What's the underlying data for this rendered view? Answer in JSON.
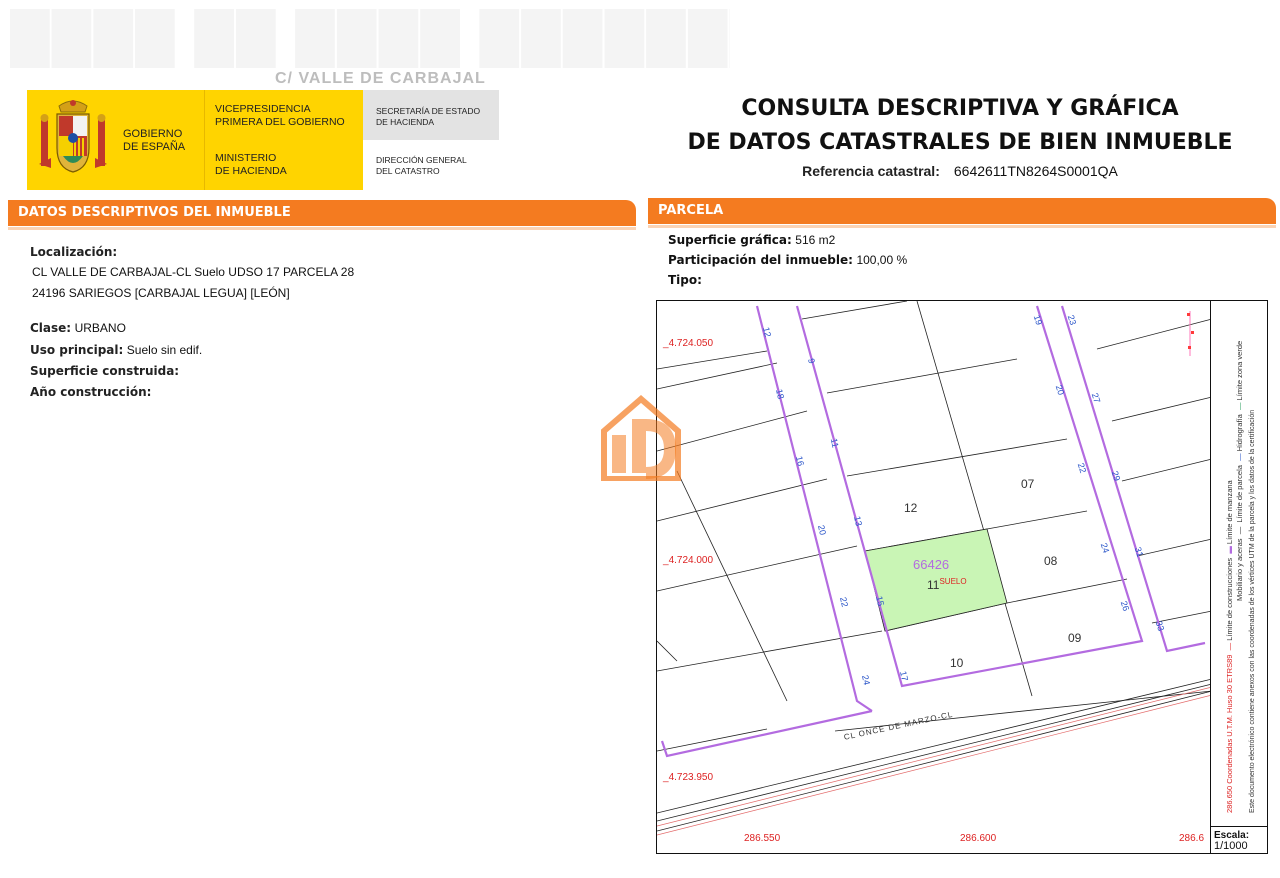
{
  "header": {
    "ghost_sub": "C/ VALLE DE CARBAJAL",
    "gobierno": "GOBIERNO\nDE ESPAÑA",
    "vicepresidencia": "VICEPRESIDENCIA\nPRIMERA DEL GOBIERNO",
    "ministerio": "MINISTERIO\nDE HACIENDA",
    "secretaria": "SECRETARÍA DE ESTADO\nDE HACIENDA",
    "direccion": "DIRECCIÓN GENERAL\nDEL CATASTRO",
    "title_line1": "CONSULTA DESCRIPTIVA Y GRÁFICA",
    "title_line2": "DE DATOS CATASTRALES DE BIEN INMUEBLE",
    "ref_label": "Referencia catastral:",
    "ref_value": "6642611TN8264S0001QA"
  },
  "descriptivos": {
    "heading": "DATOS DESCRIPTIVOS DEL INMUEBLE",
    "localizacion_label": "Localización:",
    "localizacion_line1": "CL VALLE DE CARBAJAL-CL  Suelo UDSO 17 PARCELA 28",
    "localizacion_line2": "24196 SARIEGOS [CARBAJAL LEGUA] [LEÓN]",
    "clase_label": "Clase:",
    "clase_value": "URBANO",
    "uso_label": "Uso principal:",
    "uso_value": "Suelo sin edif.",
    "superficie_label": "Superficie construida:",
    "anio_label": "Año construcción:"
  },
  "parcela": {
    "heading": "PARCELA",
    "superficie_label": "Superficie gráfica:",
    "superficie_value": "516 m2",
    "participacion_label": "Participación del inmueble:",
    "participacion_value": "100,00 %",
    "tipo_label": "Tipo:"
  },
  "map": {
    "y_labels": [
      "4.724.050",
      "4.724.000",
      "4.723.950"
    ],
    "x_labels": [
      "286.550",
      "286.600",
      "286.6"
    ],
    "manzana_label": "66426",
    "parcel_number": "11",
    "suelo_label": "SUELO",
    "street_label": "CL ONCE DE MARZO-CL",
    "parcel_labels": [
      "12",
      "07",
      "08",
      "09",
      "10"
    ],
    "street_numbers_left": [
      "12",
      "9",
      "18",
      "11",
      "16",
      "13",
      "20",
      "15",
      "22",
      "17",
      "24"
    ],
    "street_numbers_right": [
      "19",
      "23",
      "20",
      "27",
      "22",
      "29",
      "24",
      "31",
      "26",
      "33"
    ],
    "legend_1": "Límite de manzana",
    "legend_2": "Límite de parcela",
    "legend_3": "Hidrografía",
    "legend_4": "Límite de construcciones",
    "legend_5": "Mobiliario y aceras",
    "legend_6": "Límite zona verde",
    "coord_note": "286.650 Coordenadas U.T.M. Huso 30 ETRS89",
    "doc_note": "Este documento electrónico contiene anexos con las coordenadas de los vértices UTM de la parcela y los datos de la certificación",
    "scale_label": "Escala:",
    "scale_value": "1/1000"
  },
  "colors": {
    "accent_orange": "#f47b20",
    "gov_yellow": "#ffd400",
    "manzana_purple": "#b36be0",
    "parcel_green": "#c9f5b5"
  }
}
